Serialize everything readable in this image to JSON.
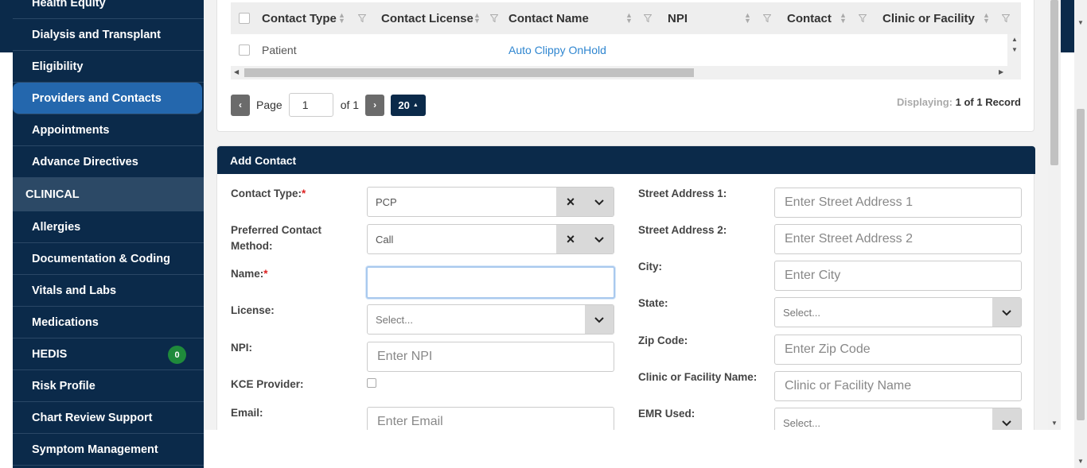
{
  "sidebar": {
    "items": [
      {
        "label": "Health Equity"
      },
      {
        "label": "Dialysis and Transplant"
      },
      {
        "label": "Eligibility"
      },
      {
        "label": "Providers and Contacts"
      },
      {
        "label": "Appointments"
      },
      {
        "label": "Advance Directives"
      }
    ],
    "section": "CLINICAL",
    "clinical_items": [
      {
        "label": "Allergies"
      },
      {
        "label": "Documentation & Coding"
      },
      {
        "label": "Vitals and Labs"
      },
      {
        "label": "Medications"
      },
      {
        "label": "HEDIS",
        "badge": "0"
      },
      {
        "label": "Risk Profile"
      },
      {
        "label": "Chart Review Support"
      },
      {
        "label": "Symptom Management"
      }
    ]
  },
  "grid": {
    "columns": [
      "Contact Type",
      "Contact License",
      "Contact Name",
      "NPI",
      "Contact",
      "Clinic or Facility"
    ],
    "rows": [
      {
        "contact_type": "Patient",
        "contact_license": "",
        "contact_name": "Auto Clippy OnHold",
        "npi": "",
        "contact": "",
        "clinic": ""
      }
    ]
  },
  "pager": {
    "page_label": "Page",
    "page_value": "1",
    "of_label": "of 1",
    "page_size": "20",
    "displaying_label": "Displaying:",
    "displaying_value": "1 of 1 Record"
  },
  "add_contact": {
    "title": "Add Contact",
    "left": {
      "contact_type_label": "Contact Type:",
      "contact_type_value": "PCP",
      "preferred_label": "Preferred Contact Method:",
      "preferred_value": "Call",
      "name_label": "Name:",
      "license_label": "License:",
      "license_placeholder": "Select...",
      "npi_label": "NPI:",
      "npi_placeholder": "Enter NPI",
      "kce_label": "KCE Provider:",
      "email_label": "Email:",
      "email_placeholder": "Enter Email"
    },
    "right": {
      "street1_label": "Street Address 1:",
      "street1_placeholder": "Enter Street Address 1",
      "street2_label": "Street Address 2:",
      "street2_placeholder": "Enter Street Address 2",
      "city_label": "City:",
      "city_placeholder": "Enter City",
      "state_label": "State:",
      "state_placeholder": "Select...",
      "zip_label": "Zip Code:",
      "zip_placeholder": "Enter Zip Code",
      "clinic_label": "Clinic or Facility Name:",
      "clinic_placeholder": "Clinic or Facility Name",
      "emr_label": "EMR Used:",
      "emr_placeholder": "Select..."
    },
    "required_mark": "*"
  },
  "colors": {
    "navy": "#0b2a4a",
    "active_blue": "#2467ad",
    "link_blue": "#2f86d0",
    "badge_green": "#1f8a3b"
  }
}
